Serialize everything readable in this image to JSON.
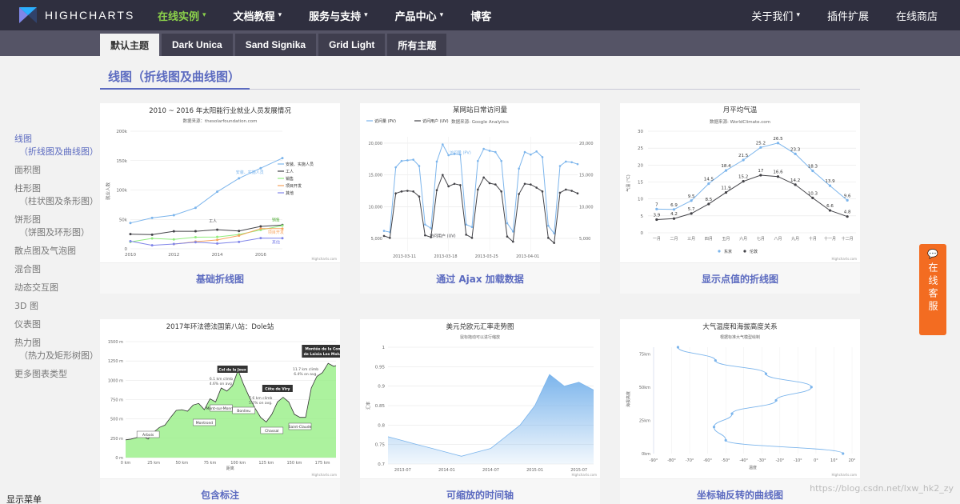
{
  "nav": {
    "brand": "HIGHCHARTS",
    "items": [
      {
        "label": "在线实例",
        "active": true,
        "caret": true
      },
      {
        "label": "文档教程",
        "active": false,
        "caret": true
      },
      {
        "label": "服务与支持",
        "active": false,
        "caret": true
      },
      {
        "label": "产品中心",
        "active": false,
        "caret": true
      },
      {
        "label": "博客",
        "active": false,
        "caret": false
      }
    ],
    "right": [
      {
        "label": "关于我们",
        "caret": true
      },
      {
        "label": "插件扩展",
        "caret": false
      },
      {
        "label": "在线商店",
        "caret": false
      }
    ],
    "caret_glyph": "▾"
  },
  "themes": [
    "默认主题",
    "Dark Unica",
    "Sand Signika",
    "Grid Light",
    "所有主题"
  ],
  "section_title": "线图（折线图及曲线图）",
  "sidebar": {
    "items": [
      {
        "label": "线图",
        "sub": "（折线图及曲线图）",
        "active": true
      },
      {
        "label": "面积图",
        "sub": ""
      },
      {
        "label": "柱形图",
        "sub": "（柱状图及条形图）"
      },
      {
        "label": "饼形图",
        "sub": "（饼图及环形图）"
      },
      {
        "label": "散点图及气泡图",
        "sub": ""
      },
      {
        "label": "混合图",
        "sub": ""
      },
      {
        "label": "动态交互图",
        "sub": ""
      },
      {
        "label": "3D 图",
        "sub": ""
      },
      {
        "label": "仪表图",
        "sub": ""
      },
      {
        "label": "热力图",
        "sub": "（热力及矩形树图）"
      },
      {
        "label": "更多图表类型",
        "sub": ""
      }
    ],
    "bottom": "显示菜单"
  },
  "cards": [
    {
      "caption": "基础折线图",
      "title": "2010 ~ 2016 年太阳能行业就业人员发展情况",
      "subtitle": "数据来源：thesolarfoundation.com",
      "ylabel": "就业人数",
      "yticks": [
        "0",
        "50k",
        "100k",
        "150k",
        "200k"
      ],
      "xticks": [
        "2010",
        "2012",
        "2014",
        "2016"
      ],
      "legend": [
        "安装、实施人员",
        "工人",
        "销售",
        "项目开发",
        "其他"
      ],
      "labels": [
        "安装、实施人员",
        "工人",
        "销售",
        "项目开发",
        "其他"
      ],
      "credit": "Highcharts.com"
    },
    {
      "caption": "通过 Ajax 加载数据",
      "title": "某网站日常访问量",
      "subtitle": "数据来源: Google Analytics",
      "legend": [
        "访问量 (PV)",
        "访问用户 (UV)"
      ],
      "yticks": [
        "5,000",
        "10,000",
        "15,000",
        "20,000"
      ],
      "xticks": [
        "2013-03-11",
        "2013-03-18",
        "2013-03-25",
        "2013-04-01"
      ],
      "labels": [
        "访问量 (PV)",
        "访问用户 (UV)"
      ]
    },
    {
      "caption": "显示点值的折线图",
      "title": "月平均气温",
      "subtitle": "数据来源: WorldClimate.com",
      "ylabel": "气温 (°C)",
      "yticks": [
        "0",
        "5",
        "10",
        "15",
        "20",
        "25",
        "30"
      ],
      "xticks": [
        "一月",
        "二月",
        "三月",
        "四月",
        "五月",
        "六月",
        "七月",
        "八月",
        "九月",
        "十月",
        "十一月",
        "十二月"
      ],
      "legend": [
        "东京",
        "伦敦"
      ],
      "credit": "Highcharts.com"
    },
    {
      "caption": "包含标注",
      "title": "2017年环法德法国第八站：Dole站",
      "yticks": [
        "0 m",
        "250 m",
        "500 m",
        "750 m",
        "1000 m",
        "1250 m",
        "1500 m"
      ],
      "xticks": [
        "0 km",
        "25 km",
        "50 km",
        "75 km",
        "100 km",
        "125 km",
        "150 km",
        "175 km"
      ],
      "xlabel": "距离",
      "annotations": [
        "Arbois",
        "Montrond",
        "Mont-sur-Monnet",
        "Bonlieu",
        "Chassal",
        "Saint-Claude"
      ],
      "dark_labels": [
        "Col de la Joux",
        "Côte de Viry",
        "Montée de la Combe de Laisia Les Molunes"
      ],
      "notes": [
        "6.1 km climb",
        "4.6% on avg.",
        "7.6 km climb",
        "5.2% on avg.",
        "11.7 km climb",
        "6.4% on avg."
      ],
      "credit": "Highcharts.com"
    },
    {
      "caption": "可缩放的时间轴",
      "title": "美元兑欧元汇率走势图",
      "subtitle": "鼠标拖动可以进行缩放",
      "ylabel": "汇率",
      "yticks": [
        "0.7",
        "0.75",
        "0.8",
        "0.85",
        "0.9",
        "0.95",
        "1"
      ],
      "xticks": [
        "2013-07",
        "2014-01",
        "2014-07",
        "2015-01",
        "2015-07"
      ],
      "credit": "Highcharts.com"
    },
    {
      "caption": "坐标轴反转的曲线图",
      "title": "大气温度和海拔高度关系",
      "subtitle": "根据标准大气模型绘制",
      "ylabel": "海拔高度",
      "yticks": [
        "0km",
        "25km",
        "50km",
        "75km"
      ],
      "xticks": [
        "-90°",
        "-80°",
        "-70°",
        "-60°",
        "-50°",
        "-40°",
        "-30°",
        "-20°",
        "-10°",
        "0°",
        "10°",
        "20°"
      ],
      "xlabel": "温度",
      "credit": "Highcharts.com"
    }
  ],
  "chart_data": [
    {
      "type": "line",
      "title": "2010 ~ 2016 年太阳能行业就业人员发展情况",
      "ylabel": "就业人数",
      "ylim": [
        0,
        200000
      ],
      "x": [
        2010,
        2011,
        2012,
        2013,
        2014,
        2015,
        2016,
        2017
      ],
      "series": [
        {
          "name": "安装、实施人员",
          "color": "#7cb5ec",
          "values": [
            43934,
            52503,
            57177,
            69658,
            97031,
            119931,
            137133,
            154175
          ]
        },
        {
          "name": "工人",
          "color": "#434348",
          "values": [
            24916,
            24064,
            29742,
            29851,
            32490,
            30282,
            38121,
            40434
          ]
        },
        {
          "name": "销售",
          "color": "#90ed7d",
          "values": [
            11744,
            17722,
            16005,
            19771,
            20185,
            24377,
            32147,
            39387
          ]
        },
        {
          "name": "项目开发",
          "color": "#f7a35c",
          "values": [
            null,
            null,
            7988,
            12169,
            15112,
            22452,
            34400,
            34227
          ]
        },
        {
          "name": "其他",
          "color": "#8085e9",
          "values": [
            12908,
            5948,
            8105,
            11248,
            8989,
            11816,
            18274,
            18111
          ]
        }
      ]
    },
    {
      "type": "line",
      "title": "某网站日常访问量",
      "ylim": [
        3000,
        21000
      ],
      "xlim": [
        0,
        33
      ],
      "series": [
        {
          "name": "访问量 (PV)",
          "color": "#7cb5ec",
          "values": [
            6200,
            6000,
            16200,
            17200,
            17300,
            17400,
            16400,
            7200,
            6600,
            17100,
            19800,
            18100,
            18300,
            18200,
            7200,
            6800,
            17200,
            19100,
            18800,
            18600,
            17200,
            7400,
            6100,
            16000,
            18600,
            18200,
            18700,
            17800,
            7000,
            5800,
            16400,
            17100,
            17000,
            16700
          ]
        },
        {
          "name": "访问用户 (UV)",
          "color": "#434348",
          "values": [
            5400,
            5100,
            12100,
            12400,
            12500,
            12400,
            11600,
            5500,
            5200,
            12600,
            15000,
            13200,
            13600,
            13400,
            5600,
            5100,
            12700,
            14600,
            13700,
            13500,
            12400,
            5300,
            4500,
            12000,
            13600,
            13500,
            13000,
            12400,
            5100,
            4300,
            12200,
            12700,
            12500,
            12100
          ]
        }
      ]
    },
    {
      "type": "line",
      "title": "月平均气温",
      "ylabel": "气温 (°C)",
      "ylim": [
        0,
        30
      ],
      "categories": [
        "一月",
        "二月",
        "三月",
        "四月",
        "五月",
        "六月",
        "七月",
        "八月",
        "九月",
        "十月",
        "十一月",
        "十二月"
      ],
      "series": [
        {
          "name": "东京",
          "color": "#7cb5ec",
          "values": [
            7.0,
            6.9,
            9.5,
            14.5,
            18.4,
            21.5,
            25.2,
            26.5,
            23.3,
            18.3,
            13.9,
            9.6
          ]
        },
        {
          "name": "伦敦",
          "color": "#434348",
          "values": [
            3.9,
            4.2,
            5.7,
            8.5,
            11.9,
            15.2,
            17.0,
            16.6,
            14.2,
            10.3,
            6.6,
            4.8
          ]
        }
      ]
    },
    {
      "type": "area",
      "title": "2017年环法德法国第八站：Dole站",
      "xlabel": "距离",
      "xlim": [
        0,
        187
      ],
      "ylim": [
        0,
        1500
      ],
      "x": [
        0,
        5,
        10,
        15,
        20,
        25,
        30,
        35,
        40,
        45,
        50,
        55,
        60,
        65,
        70,
        75,
        80,
        85,
        90,
        95,
        100,
        105,
        110,
        115,
        120,
        125,
        130,
        135,
        140,
        145,
        150,
        155,
        160,
        165,
        170,
        175,
        180,
        185,
        187
      ],
      "y": [
        230,
        240,
        260,
        280,
        240,
        330,
        390,
        420,
        520,
        610,
        620,
        600,
        680,
        700,
        620,
        760,
        720,
        900,
        860,
        930,
        1130,
        940,
        780,
        640,
        520,
        460,
        560,
        720,
        780,
        720,
        560,
        520,
        520,
        900,
        1050,
        1100,
        1220,
        1180,
        1190
      ]
    },
    {
      "type": "area",
      "title": "美元兑欧元汇率走势图",
      "ylabel": "汇率",
      "ylim": [
        0.7,
        1.0
      ],
      "x": [
        "2013-05",
        "2013-07",
        "2013-09",
        "2013-11",
        "2014-01",
        "2014-03",
        "2014-05",
        "2014-07",
        "2014-09",
        "2014-11",
        "2015-01",
        "2015-03",
        "2015-05",
        "2015-07",
        "2015-08"
      ],
      "values": [
        0.77,
        0.76,
        0.75,
        0.74,
        0.73,
        0.72,
        0.73,
        0.74,
        0.77,
        0.8,
        0.85,
        0.93,
        0.9,
        0.91,
        0.89
      ]
    },
    {
      "type": "line",
      "title": "大气温度和海拔高度关系",
      "ylabel": "海拔高度",
      "xlabel": "温度",
      "xlim": [
        -90,
        20
      ],
      "ylim": [
        0,
        80
      ],
      "x": [
        15,
        -50,
        -56.5,
        -46.5,
        -22.1,
        -2.5,
        -27.7,
        -55.7,
        -76.5
      ],
      "y": [
        0,
        10,
        20,
        30,
        40,
        50,
        60,
        70,
        80
      ]
    }
  ],
  "service": {
    "label": "在线客服",
    "bubble": "💬"
  },
  "watermark": "https://blog.csdn.net/lxw_hk2_zy"
}
